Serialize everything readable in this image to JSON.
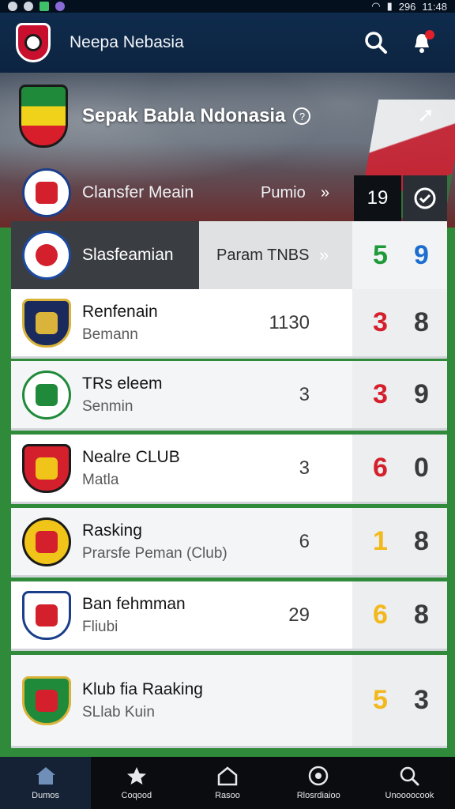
{
  "status_bar": {
    "time": "11:48",
    "battery": "296"
  },
  "app_bar": {
    "title": "Neepa Nebasia"
  },
  "hero": {
    "title": "Sepak Babla Ndonasia",
    "info_glyph": "?"
  },
  "header_row": {
    "name": "Clansfer Meain",
    "label": "Pumio",
    "chevron": "»",
    "number": "19"
  },
  "subheader_row": {
    "name": "Slasfeamian",
    "label": "Param TNBS",
    "chevron": "»",
    "score1": "5",
    "score2": "9"
  },
  "clubs": [
    {
      "name": "Renfenain",
      "sub": "Bemann",
      "rank": "1130",
      "score1": "3",
      "score2": "8",
      "score1_color": "#d4202c"
    },
    {
      "name": "TRs eleem",
      "sub": "Senmin",
      "rank": "3",
      "score1": "3",
      "score2": "9",
      "score1_color": "#d4202c"
    },
    {
      "name": "Nealre CLUB",
      "sub": "Matla",
      "rank": "3",
      "score1": "6",
      "score2": "0",
      "score1_color": "#d4202c"
    },
    {
      "name": "Rasking",
      "sub": "Prarsfe Peman (Club)",
      "rank": "6",
      "score1": "1",
      "score2": "8",
      "score1_color": "#f2b81c"
    },
    {
      "name": "Ban fehmman",
      "sub": "Fliubi",
      "rank": "29",
      "score1": "6",
      "score2": "8",
      "score1_color": "#f2b81c"
    },
    {
      "name": "Klub fia Raaking",
      "sub": "SLlab Kuin",
      "rank": "",
      "score1": "5",
      "score2": "3",
      "score1_color": "#f2b81c"
    }
  ],
  "nav": [
    {
      "label": "Dumos",
      "icon": "home-icon"
    },
    {
      "label": "Coqood",
      "icon": "star-icon"
    },
    {
      "label": "Rasoo",
      "icon": "house-outline-icon"
    },
    {
      "label": "Rlosrdiaioo",
      "icon": "club-badge-icon"
    },
    {
      "label": "Unoooocook",
      "icon": "search-icon"
    }
  ],
  "colors": {
    "green": "#1f9a3a",
    "blue": "#1b6ed0",
    "red": "#d4202c",
    "yellow": "#f2b81c"
  }
}
